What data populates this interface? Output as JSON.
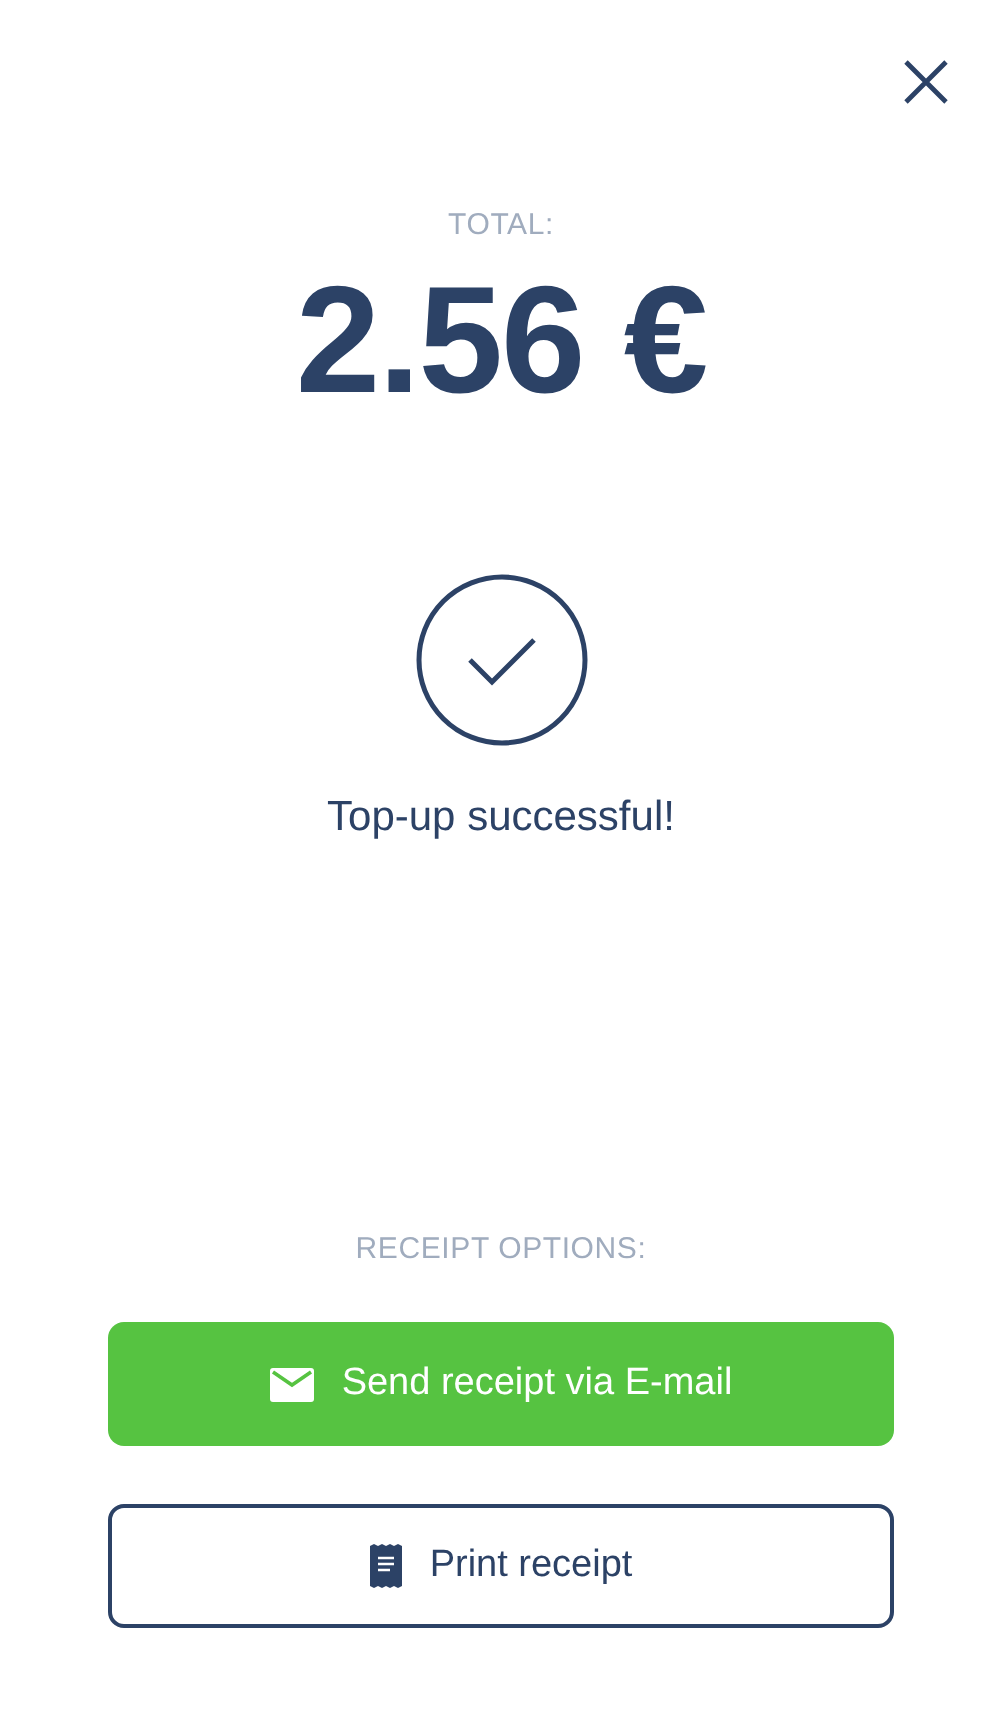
{
  "total_label": "TOTAL:",
  "amount": "2.56 €",
  "status": {
    "message": "Top-up successful!",
    "success": true
  },
  "receipt_label": "RECEIPT OPTIONS:",
  "buttons": [
    {
      "label": "Send receipt via E-mail",
      "kind": "filled"
    },
    {
      "label": "Print receipt",
      "kind": "outline"
    }
  ]
}
